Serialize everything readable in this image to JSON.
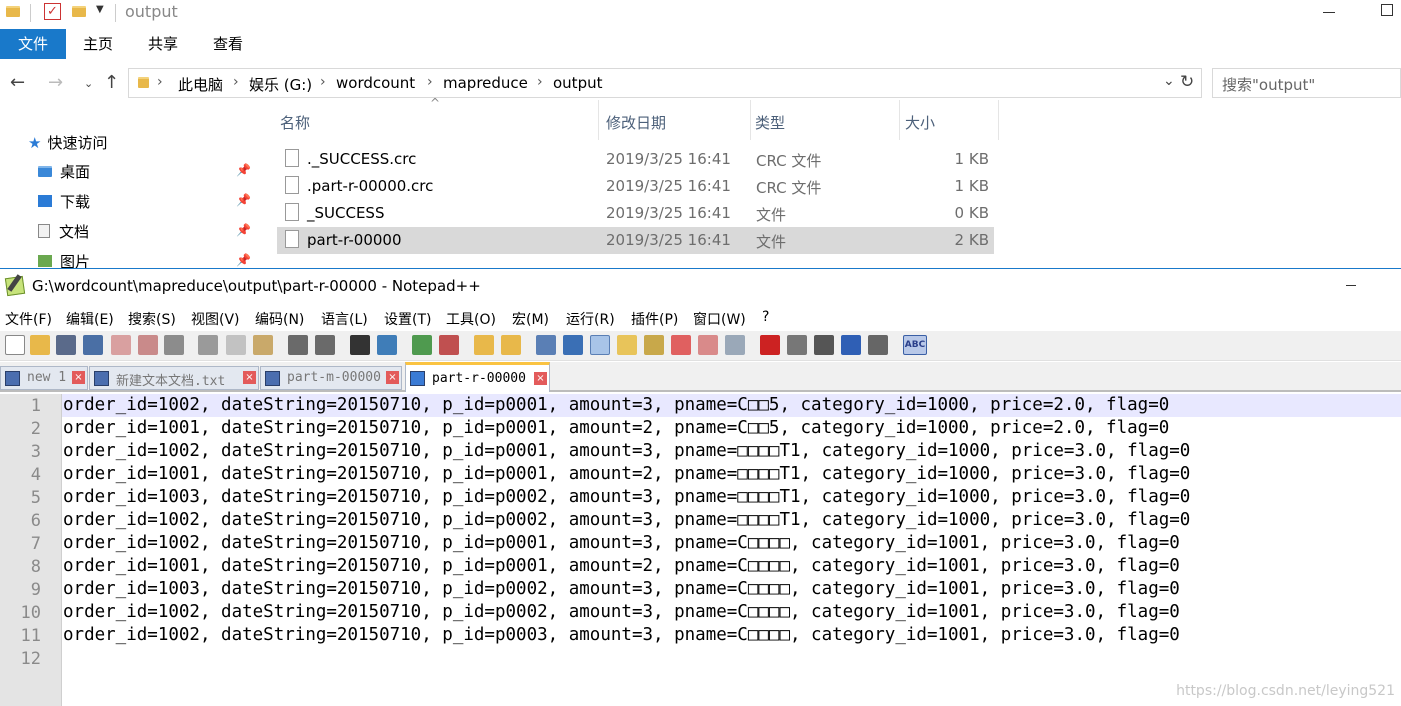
{
  "explorer": {
    "title": "output",
    "ribbon_tabs": [
      "文件",
      "主页",
      "共享",
      "查看"
    ],
    "address": {
      "crumbs": [
        "此电脑",
        "娱乐 (G:)",
        "wordcount",
        "mapreduce",
        "output"
      ]
    },
    "search_placeholder": "搜索\"output\"",
    "nav": {
      "quick_access": "快速访问",
      "items": [
        "桌面",
        "下载",
        "文档",
        "图片"
      ]
    },
    "columns": {
      "name": "名称",
      "date": "修改日期",
      "type": "类型",
      "size": "大小"
    },
    "files": [
      {
        "name": "._SUCCESS.crc",
        "date": "2019/3/25 16:41",
        "type": "CRC 文件",
        "size": "1 KB"
      },
      {
        "name": ".part-r-00000.crc",
        "date": "2019/3/25 16:41",
        "type": "CRC 文件",
        "size": "1 KB"
      },
      {
        "name": "_SUCCESS",
        "date": "2019/3/25 16:41",
        "type": "文件",
        "size": "0 KB"
      },
      {
        "name": "part-r-00000",
        "date": "2019/3/25 16:41",
        "type": "文件",
        "size": "2 KB"
      }
    ]
  },
  "npp": {
    "title": "G:\\wordcount\\mapreduce\\output\\part-r-00000 - Notepad++",
    "menu": [
      "文件(F)",
      "编辑(E)",
      "搜索(S)",
      "视图(V)",
      "编码(N)",
      "语言(L)",
      "设置(T)",
      "工具(O)",
      "宏(M)",
      "运行(R)",
      "插件(P)",
      "窗口(W)",
      "?"
    ],
    "tabs": [
      "new 1",
      "新建文本文档.txt",
      "part-m-00000",
      "part-r-00000"
    ],
    "line_numbers": [
      "1",
      "2",
      "3",
      "4",
      "5",
      "6",
      "7",
      "8",
      "9",
      "10",
      "11",
      "12"
    ],
    "lines": [
      "order_id=1002, dateString=20150710, p_id=p0001, amount=3, pname=C□□5, category_id=1000, price=2.0, flag=0",
      "order_id=1001, dateString=20150710, p_id=p0001, amount=2, pname=C□□5, category_id=1000, price=2.0, flag=0",
      "order_id=1002, dateString=20150710, p_id=p0001, amount=3, pname=□□□□T1, category_id=1000, price=3.0, flag=0",
      "order_id=1001, dateString=20150710, p_id=p0001, amount=2, pname=□□□□T1, category_id=1000, price=3.0, flag=0",
      "order_id=1003, dateString=20150710, p_id=p0002, amount=3, pname=□□□□T1, category_id=1000, price=3.0, flag=0",
      "order_id=1002, dateString=20150710, p_id=p0002, amount=3, pname=□□□□T1, category_id=1000, price=3.0, flag=0",
      "order_id=1002, dateString=20150710, p_id=p0001, amount=3, pname=C□□□□, category_id=1001, price=3.0, flag=0",
      "order_id=1001, dateString=20150710, p_id=p0001, amount=2, pname=C□□□□, category_id=1001, price=3.0, flag=0",
      "order_id=1003, dateString=20150710, p_id=p0002, amount=3, pname=C□□□□, category_id=1001, price=3.0, flag=0",
      "order_id=1002, dateString=20150710, p_id=p0002, amount=3, pname=C□□□□, category_id=1001, price=3.0, flag=0",
      "order_id=1002, dateString=20150710, p_id=p0003, amount=3, pname=C□□□□, category_id=1001, price=3.0, flag=0",
      ""
    ]
  },
  "watermark": "https://blog.csdn.net/leying521"
}
